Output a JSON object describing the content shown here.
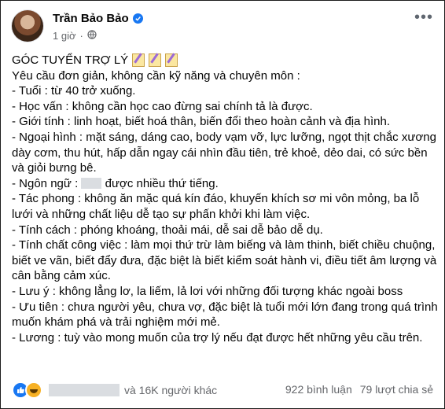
{
  "post": {
    "author": "Trần Bảo Bảo",
    "time": "1 giờ",
    "title": "GÓC TUYỂN TRỢ LÝ",
    "lines": [
      "Yêu cầu đơn giản, không cần kỹ năng và chuyên môn :",
      "- Tuổi : từ 40 trở xuống.",
      "- Học vấn : không cần học cao đừng sai chính tả là được.",
      "- Giới tính : linh hoạt, biết hoá thân, biến đổi theo hoàn cảnh và địa hình.",
      "- Ngoại hình : mặt sáng, dáng cao, body vạm vỡ, lực lưỡng, ngọt thịt chắc xương dày cơm, thu hút, hấp dẫn ngay cái nhìn đầu tiên, trẻ khoẻ, dẻo dai, có sức bền và giỏi bưng bê."
    ],
    "language_prefix": "- Ngôn ngữ :",
    "language_suffix": "được nhiều thứ tiếng.",
    "lines2": [
      "- Tác phong : không ăn mặc quá kín đáo, khuyến khích sơ mi vôn mỏng, ba lỗ lưới và những chất liệu dễ tạo sự phấn khởi khi làm việc.",
      "- Tính cách : phóng khoáng, thoải mái, dễ sai dễ bảo dễ dụ.",
      "- Tính chất công việc : làm mọi thứ trừ làm biếng và làm thinh, biết chiều chuộng, biết ve vãn, biết đẩy đưa, đặc biệt là biết kiểm soát hành vi, điều tiết âm lượng và cân bằng cảm xúc.",
      "- Lưu ý : không lẳng lơ, la liếm, lả lơi với những đối tượng khác ngoài boss",
      "- Ưu tiên : chưa người yêu, chưa vợ, đặc biệt là tuổi mới lớn đang trong quá trình muốn khám phá và trải nghiệm mới mẻ.",
      "- Lương : tuỳ vào mong muốn của trợ lý nếu đạt được hết những yêu cầu trên."
    ]
  },
  "footer": {
    "reactions_text": "và 16K người khác",
    "comments": "922 bình luận",
    "shares": "79 lượt chia sẻ"
  },
  "colors": {
    "accent": "#1877f2",
    "muted": "#65676b"
  }
}
